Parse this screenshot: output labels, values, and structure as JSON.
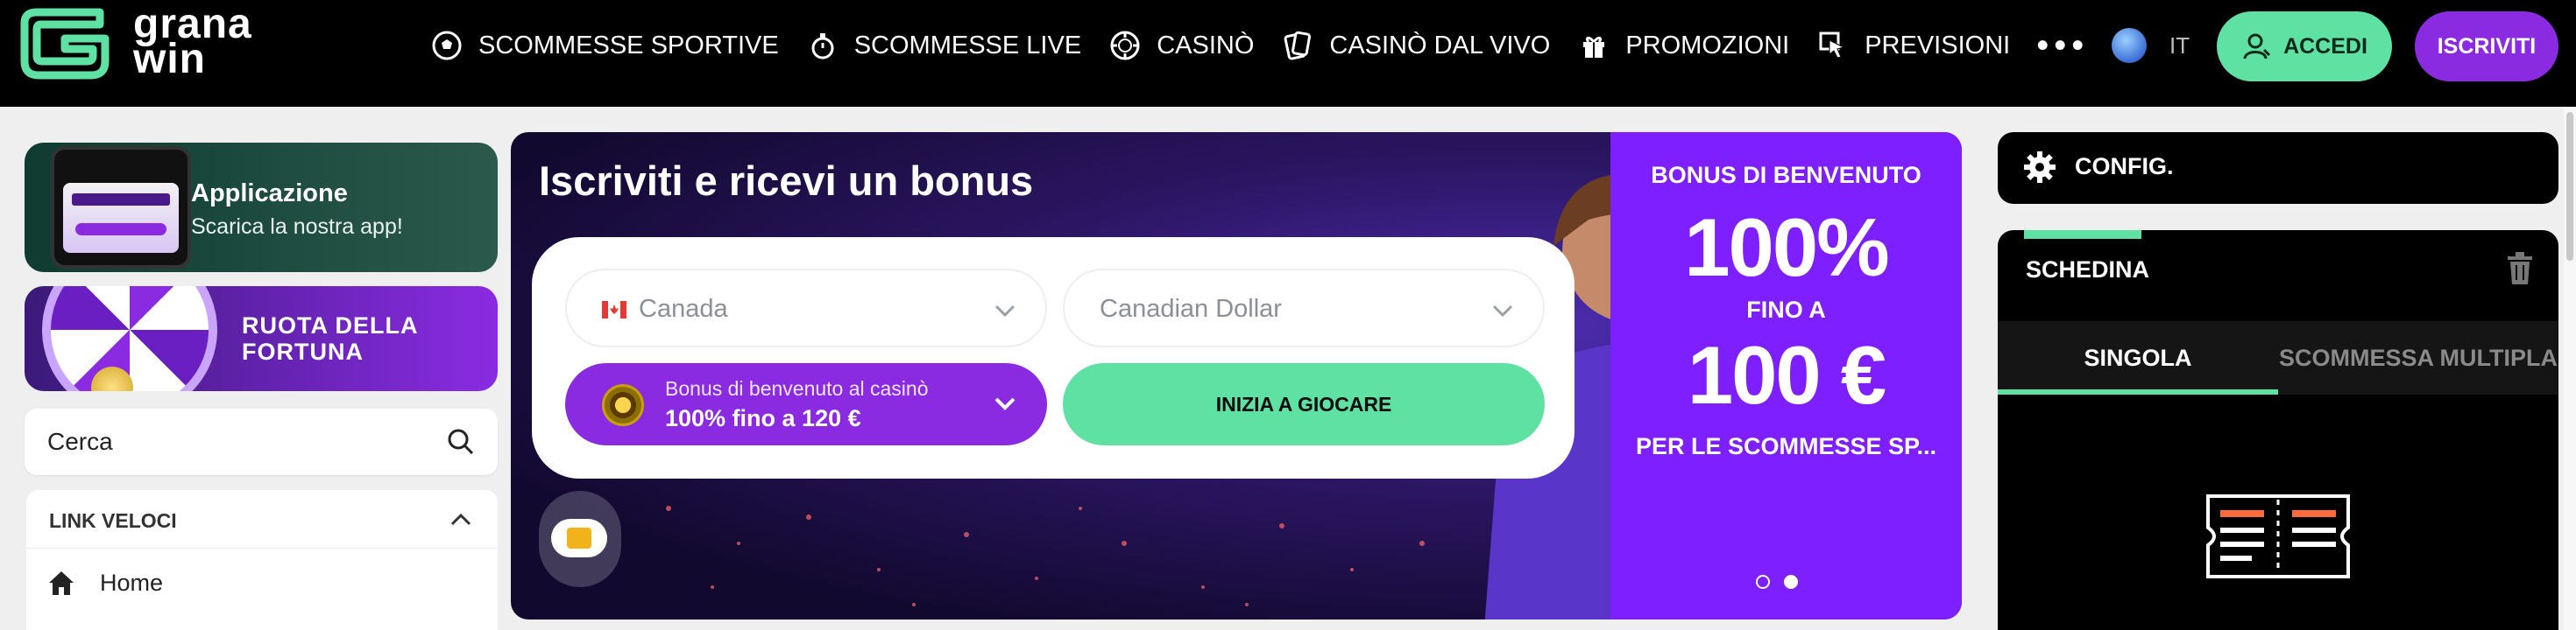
{
  "header": {
    "logo_text_line1": "grana",
    "logo_text_line2": "win",
    "nav": [
      {
        "label": "SCOMMESSE SPORTIVE",
        "icon": "soccer-ball-icon"
      },
      {
        "label": "SCOMMESSE LIVE",
        "icon": "stopwatch-icon"
      },
      {
        "label": "CASINÒ",
        "icon": "casino-chip-icon"
      },
      {
        "label": "CASINÒ DAL VIVO",
        "icon": "playing-cards-icon"
      },
      {
        "label": "PROMOZIONI",
        "icon": "gift-icon"
      },
      {
        "label": "PREVISIONI",
        "icon": "cursor-click-icon"
      }
    ],
    "more": "•••",
    "language": "IT",
    "login_label": "ACCEDI",
    "register_label": "ISCRIVITI"
  },
  "sidebar": {
    "app_promo": {
      "title": "Applicazione",
      "subtitle": "Scarica la nostra app!"
    },
    "wheel_promo": {
      "line1": "RUOTA DELLA",
      "line2": "FORTUNA"
    },
    "search_label": "Cerca",
    "quick_links": {
      "title": "LINK VELOCI",
      "items": [
        {
          "label": "Home"
        }
      ]
    }
  },
  "hero": {
    "title": "Iscriviti e ricevi un bonus",
    "country": "Canada",
    "currency": "Canadian Dollar",
    "bonus_line1": "Bonus di benvenuto al casinò",
    "bonus_line2": "100% fino a 120 €",
    "play_label": "INIZIA A GIOCARE",
    "right": {
      "line1": "BONUS DI BENVENUTO",
      "line2": "100%",
      "line3": "FINO A",
      "line4": "100 €",
      "line5": "PER LE SCOMMESSE SP..."
    },
    "pager": {
      "total": 2,
      "active": 2
    }
  },
  "right": {
    "config_label": "CONFIG.",
    "slip_title": "SCHEDINA",
    "tab_single": "SINGOLA",
    "tab_multi": "SCOMMESSA MULTIPLA"
  },
  "colors": {
    "accent_green": "#5fe1a4",
    "accent_purple": "#8a2be2",
    "hero_panel": "#7d1fff"
  }
}
